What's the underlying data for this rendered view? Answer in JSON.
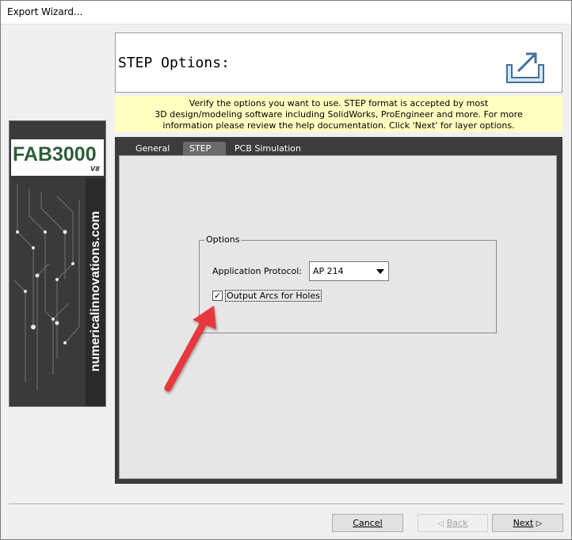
{
  "window": {
    "title": "Export Wizard..."
  },
  "header": {
    "title": "STEP Options:",
    "icon": "export-icon"
  },
  "info": {
    "lines": [
      "Verify the options you want to use.  STEP format is accepted by most",
      "3D design/modeling software including SolidWorks, ProEngineer and more.  For more",
      "information please review the help documentation. Click 'Next' for layer options."
    ]
  },
  "logo": {
    "brand": "FAB3000",
    "version": "V8",
    "website": "numericalinnovations.com"
  },
  "tabs": [
    {
      "label": "General",
      "active": false
    },
    {
      "label": "STEP",
      "active": true
    },
    {
      "label": "PCB Simulation",
      "active": false
    }
  ],
  "options": {
    "group_label": "Options",
    "protocol_label": "Application Protocol:",
    "protocol_value": "AP 214",
    "arcs_label": "Output Arcs for Holes",
    "arcs_checked": true
  },
  "buttons": {
    "cancel": "Cancel",
    "back": "Back",
    "next": "Next"
  },
  "colors": {
    "annotation_arrow": "#e8383d",
    "banner": "#ffffc0",
    "logo_green": "#2d5d3b"
  }
}
